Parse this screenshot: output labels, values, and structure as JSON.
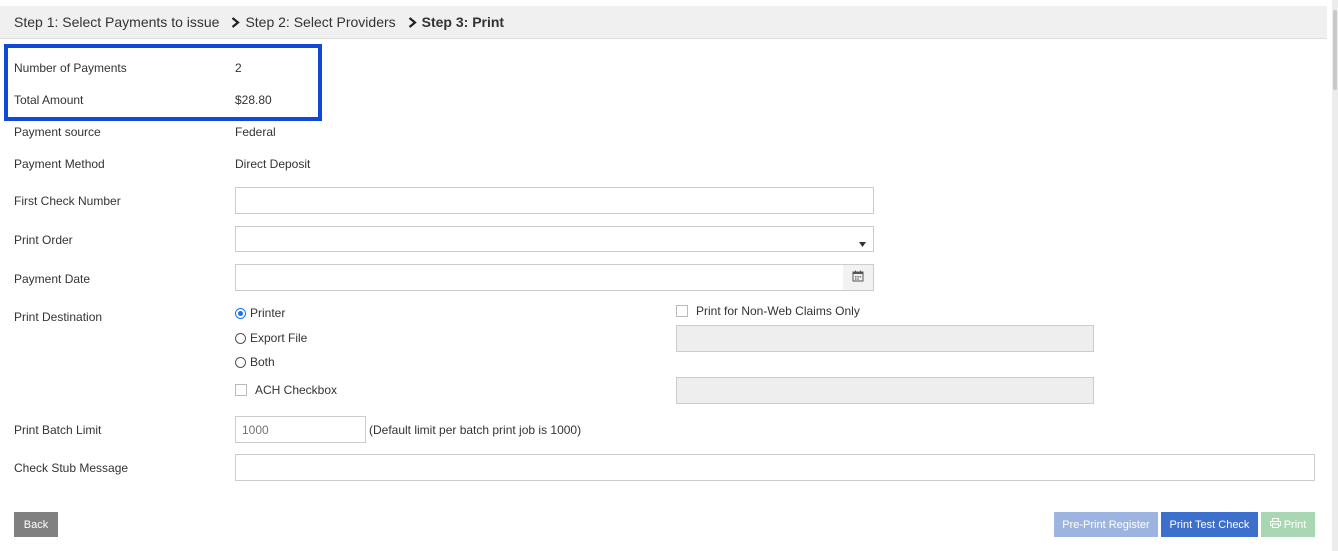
{
  "breadcrumb": {
    "step1": "Step 1: Select Payments to issue",
    "step2": "Step 2: Select Providers",
    "step3": "Step 3: Print"
  },
  "summary": {
    "num_payments_label": "Number of Payments",
    "num_payments_value": "2",
    "total_amount_label": "Total Amount",
    "total_amount_value": "$28.80",
    "payment_source_label": "Payment source",
    "payment_source_value": "Federal",
    "payment_method_label": "Payment Method",
    "payment_method_value": "Direct Deposit"
  },
  "form": {
    "first_check_label": "First Check Number",
    "first_check_value": "",
    "print_order_label": "Print Order",
    "print_order_value": "",
    "payment_date_label": "Payment Date",
    "payment_date_value": "",
    "print_destination_label": "Print Destination",
    "destinations": {
      "printer": "Printer",
      "export_file": "Export File",
      "both": "Both",
      "selected": "Printer"
    },
    "ach_checkbox_label": "ACH Checkbox",
    "non_web_label": "Print for Non-Web Claims Only",
    "batch_limit_label": "Print Batch Limit",
    "batch_limit_placeholder": "1000",
    "batch_limit_hint": "(Default limit per batch print job is 1000)",
    "stub_message_label": "Check Stub Message",
    "stub_message_value": ""
  },
  "buttons": {
    "back": "Back",
    "pre_print_register": "Pre-Print Register",
    "print_test_check": "Print Test Check",
    "print": "Print"
  },
  "colors": {
    "highlight_border": "#1048d8",
    "primary_button": "#3d6fcc",
    "disabled_primary": "#9db4e0",
    "disabled_success": "#a9d7b4",
    "back_button": "#808080"
  },
  "icons": {
    "chevron": "chevron-right-icon",
    "calendar": "calendar-icon",
    "printer": "printer-icon"
  }
}
